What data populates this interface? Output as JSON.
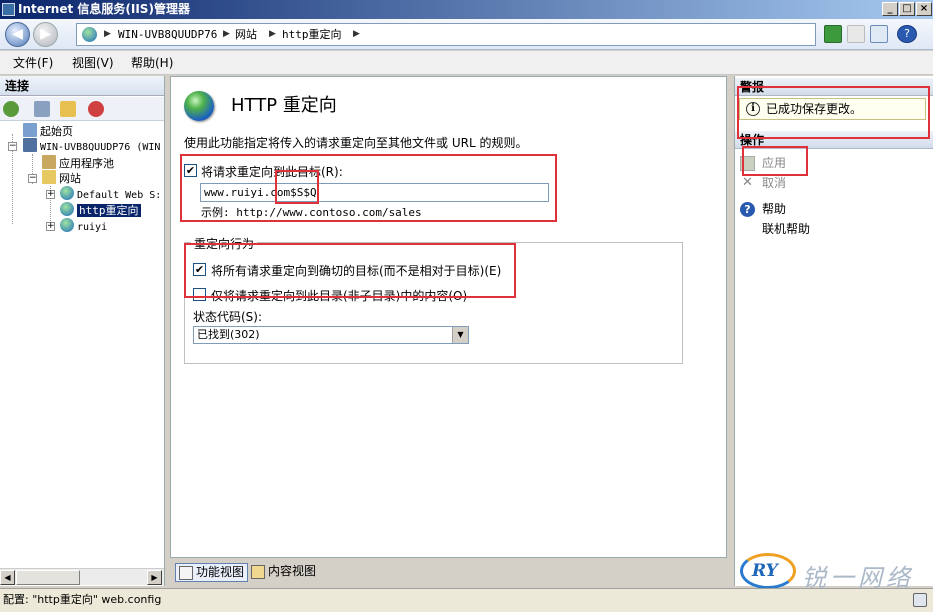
{
  "window": {
    "title": "Internet 信息服务(IIS)管理器",
    "minimize": "_",
    "maximize": "□",
    "close": "×"
  },
  "address": {
    "back": "◀",
    "forward": "▶",
    "crumbs": [
      "WIN-UVB8QUUDP76",
      "网站",
      "http重定向"
    ],
    "separator": "▶",
    "help_glyph": "?"
  },
  "menu": {
    "file": "文件(F)",
    "view": "视图(V)",
    "help": "帮助(H)"
  },
  "connections": {
    "header": "连接",
    "tree": {
      "start_page": "起始页",
      "server": "WIN-UVB8QUUDP76 (WIN",
      "app_pools": "应用程序池",
      "sites": "网站",
      "default_site": "Default Web S:",
      "http_redirect": "http重定向",
      "ruiyi": "ruiyi"
    }
  },
  "main": {
    "title": "HTTP 重定向",
    "description": "使用此功能指定将传入的请求重定向至其他文件或 URL 的规则。",
    "redirect_checkbox_label": "将请求重定向到此目标(R):",
    "redirect_checked": true,
    "target_value": "www.ruiyi.com$S$Q",
    "example": "示例: http://www.contoso.com/sales",
    "behavior_title": "重定向行为",
    "exact_label": "将所有请求重定向到确切的目标(而不是相对于目标)(E)",
    "exact_checked": true,
    "only_dir_label": "仅将请求重定向到此目录(非子目录)中的内容(O)",
    "only_dir_checked": false,
    "status_code_label": "状态代码(S):",
    "status_code_value": "已找到(302)"
  },
  "view_tabs": {
    "features": "功能视图",
    "content": "内容视图"
  },
  "actions": {
    "alerts_header": "警报",
    "alert_message": "已成功保存更改。",
    "actions_header": "操作",
    "apply": "应用",
    "cancel": "取消",
    "help": "帮助",
    "online_help": "联机帮助"
  },
  "statusbar": {
    "text": "配置: \"http重定向\" web.config"
  },
  "logo": {
    "mark": "RY",
    "text": "锐一网络"
  },
  "colors": {
    "annotation": "#e0303a",
    "title_gradient_start": "#0a246a",
    "title_gradient_end": "#a6caf0"
  }
}
